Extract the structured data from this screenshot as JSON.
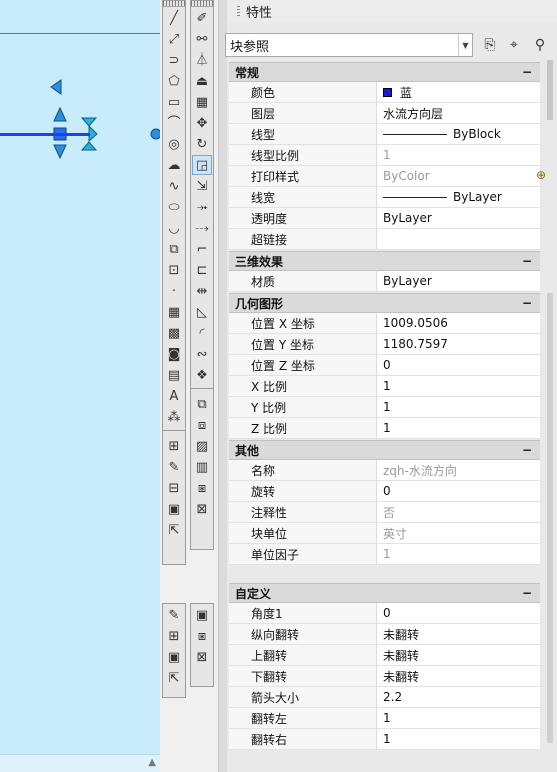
{
  "palette": {
    "title": "特性",
    "object_type": "块参照"
  },
  "sections": [
    {
      "label": "常规",
      "toggle": "−",
      "rows": [
        {
          "key": "颜色",
          "value": "蓝",
          "swatch": "#1a1acc"
        },
        {
          "key": "图层",
          "value": "水流方向层"
        },
        {
          "key": "线型",
          "value": "ByBlock",
          "line": true
        },
        {
          "key": "线型比例",
          "value": "1",
          "gray": true
        },
        {
          "key": "打印样式",
          "value": "ByColor",
          "gray": true
        },
        {
          "key": "线宽",
          "value": "ByLayer",
          "line": true
        },
        {
          "key": "透明度",
          "value": "ByLayer"
        },
        {
          "key": "超链接",
          "value": ""
        }
      ]
    },
    {
      "label": "三维效果",
      "toggle": "−",
      "rows": [
        {
          "key": "材质",
          "value": "ByLayer"
        }
      ]
    },
    {
      "label": "几何图形",
      "toggle": "−",
      "rows": [
        {
          "key": "位置 X 坐标",
          "value": "1009.0506"
        },
        {
          "key": "位置 Y 坐标",
          "value": "1180.7597"
        },
        {
          "key": "位置 Z 坐标",
          "value": "0"
        },
        {
          "key": "X 比例",
          "value": "1"
        },
        {
          "key": "Y 比例",
          "value": "1"
        },
        {
          "key": "Z 比例",
          "value": "1"
        }
      ]
    },
    {
      "label": "其他",
      "toggle": "−",
      "rows": [
        {
          "key": "名称",
          "value": "zqh-水流方向",
          "gray": true
        },
        {
          "key": "旋转",
          "value": "0"
        },
        {
          "key": "注释性",
          "value": "否",
          "gray": true
        },
        {
          "key": "块单位",
          "value": "英寸",
          "gray": true
        },
        {
          "key": "单位因子",
          "value": "1",
          "gray": true
        }
      ]
    }
  ],
  "custom": {
    "label": "自定义",
    "toggle": "−",
    "rows": [
      {
        "key": "角度1",
        "value": "0"
      },
      {
        "key": "纵向翻转",
        "value": "未翻转"
      },
      {
        "key": "上翻转",
        "value": "未翻转"
      },
      {
        "key": "下翻转",
        "value": "未翻转"
      },
      {
        "key": "箭头大小",
        "value": "2.2"
      },
      {
        "key": "翻转左",
        "value": "1"
      },
      {
        "key": "翻转右",
        "value": "1"
      }
    ]
  },
  "toolbar_icons": {
    "draw": [
      "line-icon",
      "construction-line-icon",
      "polyline-icon",
      "polygon-icon",
      "rectangle-icon",
      "arc-icon",
      "circle-icon",
      "revision-cloud-icon",
      "spline-icon",
      "ellipse-icon",
      "ellipse-arc-icon",
      "insert-block-icon",
      "make-block-icon",
      "point-icon",
      "hatch-icon",
      "gradient-icon",
      "region-icon",
      "table-icon",
      "multiline-text-icon",
      "add-selected-icon"
    ],
    "modify": [
      "erase-icon",
      "copy-icon",
      "mirror-icon",
      "offset-icon",
      "array-icon",
      "move-icon",
      "rotate-icon",
      "scale-icon",
      "stretch-icon",
      "trim-icon",
      "extend-icon",
      "break-at-point-icon",
      "break-icon",
      "join-icon",
      "chamfer-icon",
      "fillet-icon",
      "blend-curves-icon",
      "explode-icon"
    ]
  },
  "text_icons": {
    "multiline_text": "A"
  }
}
